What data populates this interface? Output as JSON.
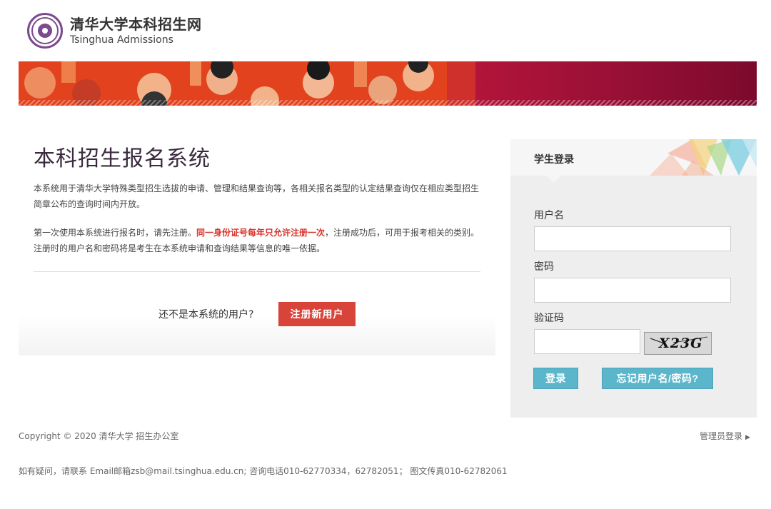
{
  "header": {
    "site_name_cn": "清华大学本科招生网",
    "site_name_en": "Tsinghua Admissions",
    "logo_icon": "tsinghua-seal-icon"
  },
  "intro": {
    "title": "本科招生报名系统",
    "para1": "本系统用于清华大学特殊类型招生选拔的申请、管理和结果查询等，各相关报名类型的认定结果查询仅在相应类型招生简章公布的查询时间内开放。",
    "para2_before": "第一次使用本系统进行报名时，请先注册。",
    "para2_warning": "同一身份证号每年只允许注册一次",
    "para2_after": "，注册成功后，可用于报考相关的类别。注册时的用户名和密码将是考生在本系统申请和查询结果等信息的唯一依据。",
    "register_question": "还不是本系统的用户?",
    "register_button": "注册新用户",
    "warning_color": "#d9332b",
    "button_color": "#d8443a"
  },
  "login": {
    "title": "学生登录",
    "username_label": "用户名",
    "username_value": "",
    "password_label": "密码",
    "password_value": "",
    "captcha_label": "验证码",
    "captcha_value": "",
    "captcha_text": "X23G",
    "login_button": "登录",
    "forgot_button": "忘记用户名/密码?",
    "button_color": "#5bb6cb"
  },
  "footer": {
    "copyright": "Copyright © 2020 清华大学 招生办公室",
    "admin_login": "管理员登录",
    "contact": "如有疑问，请联系 Email邮箱zsb@mail.tsinghua.edu.cn; 咨询电话010-62770334，62782051； 图文传真010-62782061"
  }
}
